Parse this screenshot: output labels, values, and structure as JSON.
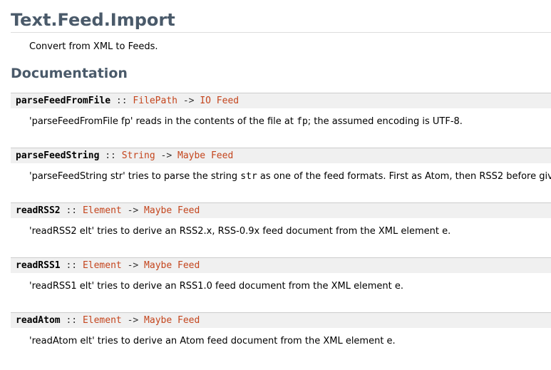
{
  "module": {
    "title": "Text.Feed.Import",
    "description": "Convert from XML to Feeds."
  },
  "section": {
    "heading": "Documentation"
  },
  "entries": [
    {
      "name": "parseFeedFromFile",
      "sep": "::",
      "arg": "FilePath",
      "arrow": "->",
      "ret": "IO Feed",
      "doc_before": "'parseFeedFromFile fp' reads in the contents of the file at ",
      "doc_code": "fp",
      "doc_after": "; the assumed encoding is UTF-8."
    },
    {
      "name": "parseFeedString",
      "sep": "::",
      "arg": "String",
      "arrow": "->",
      "ret": "Maybe Feed",
      "doc_before": "'parseFeedString str' tries to parse the string ",
      "doc_code": "str",
      "doc_after": " as one of the feed formats. First as Atom, then RSS2 before giv"
    },
    {
      "name": "readRSS2",
      "sep": "::",
      "arg": "Element",
      "arrow": "->",
      "ret": "Maybe Feed",
      "doc_before": "'readRSS2 elt' tries to derive an RSS2.x, RSS-0.9x feed document from the XML element e.",
      "doc_code": "",
      "doc_after": ""
    },
    {
      "name": "readRSS1",
      "sep": "::",
      "arg": "Element",
      "arrow": "->",
      "ret": "Maybe Feed",
      "doc_before": "'readRSS1 elt' tries to derive an RSS1.0 feed document from the XML element e.",
      "doc_code": "",
      "doc_after": ""
    },
    {
      "name": "readAtom",
      "sep": "::",
      "arg": "Element",
      "arrow": "->",
      "ret": "Maybe Feed",
      "doc_before": "'readAtom elt' tries to derive an Atom feed document from the XML element e.",
      "doc_code": "",
      "doc_after": ""
    }
  ],
  "colors": {
    "heading": "#4a5a6a",
    "type_link": "#c4451d",
    "decl_background": "#f0f0f0"
  }
}
